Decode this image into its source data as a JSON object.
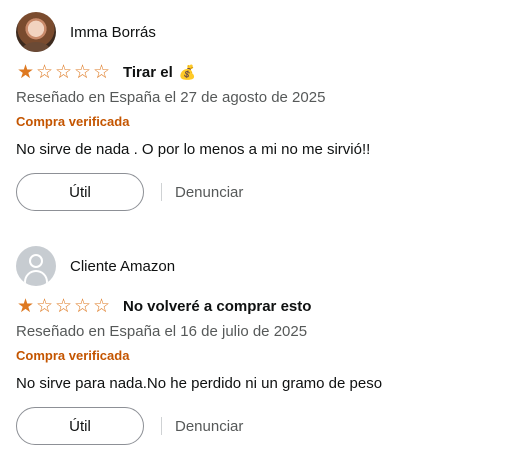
{
  "reviews": [
    {
      "author": "Imma Borrás",
      "avatar": "profile-photo",
      "rating": 1,
      "rating_max": 5,
      "title": "Tirar el",
      "title_emoji": "💰",
      "date": "Reseñado en España el 27 de agosto de 2025",
      "verified": "Compra verificada",
      "body": "No sirve de nada . O por lo menos a mi no me sirvió!!",
      "helpful_label": "Útil",
      "report_label": "Denunciar"
    },
    {
      "author": "Cliente Amazon",
      "avatar": "default-user-icon",
      "rating": 1,
      "rating_max": 5,
      "title": "No volveré a comprar esto",
      "date": "Reseñado en España el 16 de julio de 2025",
      "verified": "Compra verificada",
      "body": "No sirve para nada.No he perdido ni un gramo de peso",
      "helpful_label": "Útil",
      "report_label": "Denunciar"
    }
  ],
  "colors": {
    "star": "#de7921",
    "verified": "#c45500",
    "secondary_text": "#565959",
    "primary_text": "#0f1111"
  }
}
